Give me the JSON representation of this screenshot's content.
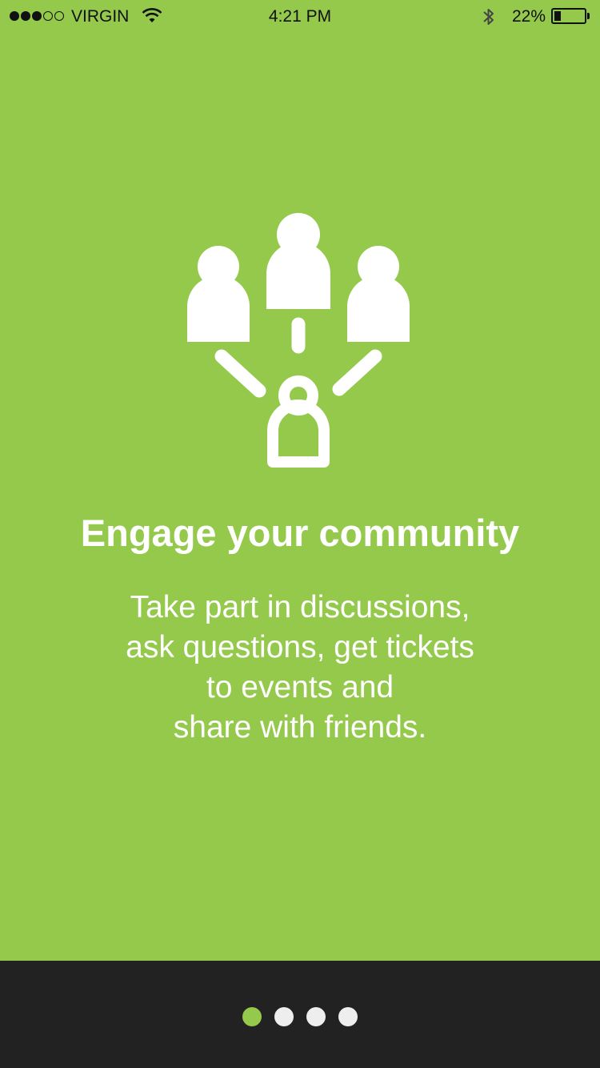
{
  "status_bar": {
    "signal_filled": 3,
    "signal_empty": 2,
    "carrier": "VIRGIN",
    "time": "4:21 PM",
    "battery_percent": "22%",
    "battery_level": 0.22
  },
  "onboarding": {
    "headline": "Engage your community",
    "body_lines": [
      "Take part in discussions,",
      "ask questions, get tickets",
      "to events and",
      "share with friends."
    ]
  },
  "pager": {
    "total_pages": 4,
    "active_page": 1,
    "active_color": "#94c94c",
    "inactive_color": "#eeeeee"
  },
  "colors": {
    "background": "#94c94c",
    "bottom_bar": "#222222",
    "text": "#ffffff"
  },
  "icons": {
    "illustration": "community-people-icon",
    "wifi": "wifi-icon",
    "bluetooth": "bluetooth-icon",
    "battery": "battery-icon"
  }
}
